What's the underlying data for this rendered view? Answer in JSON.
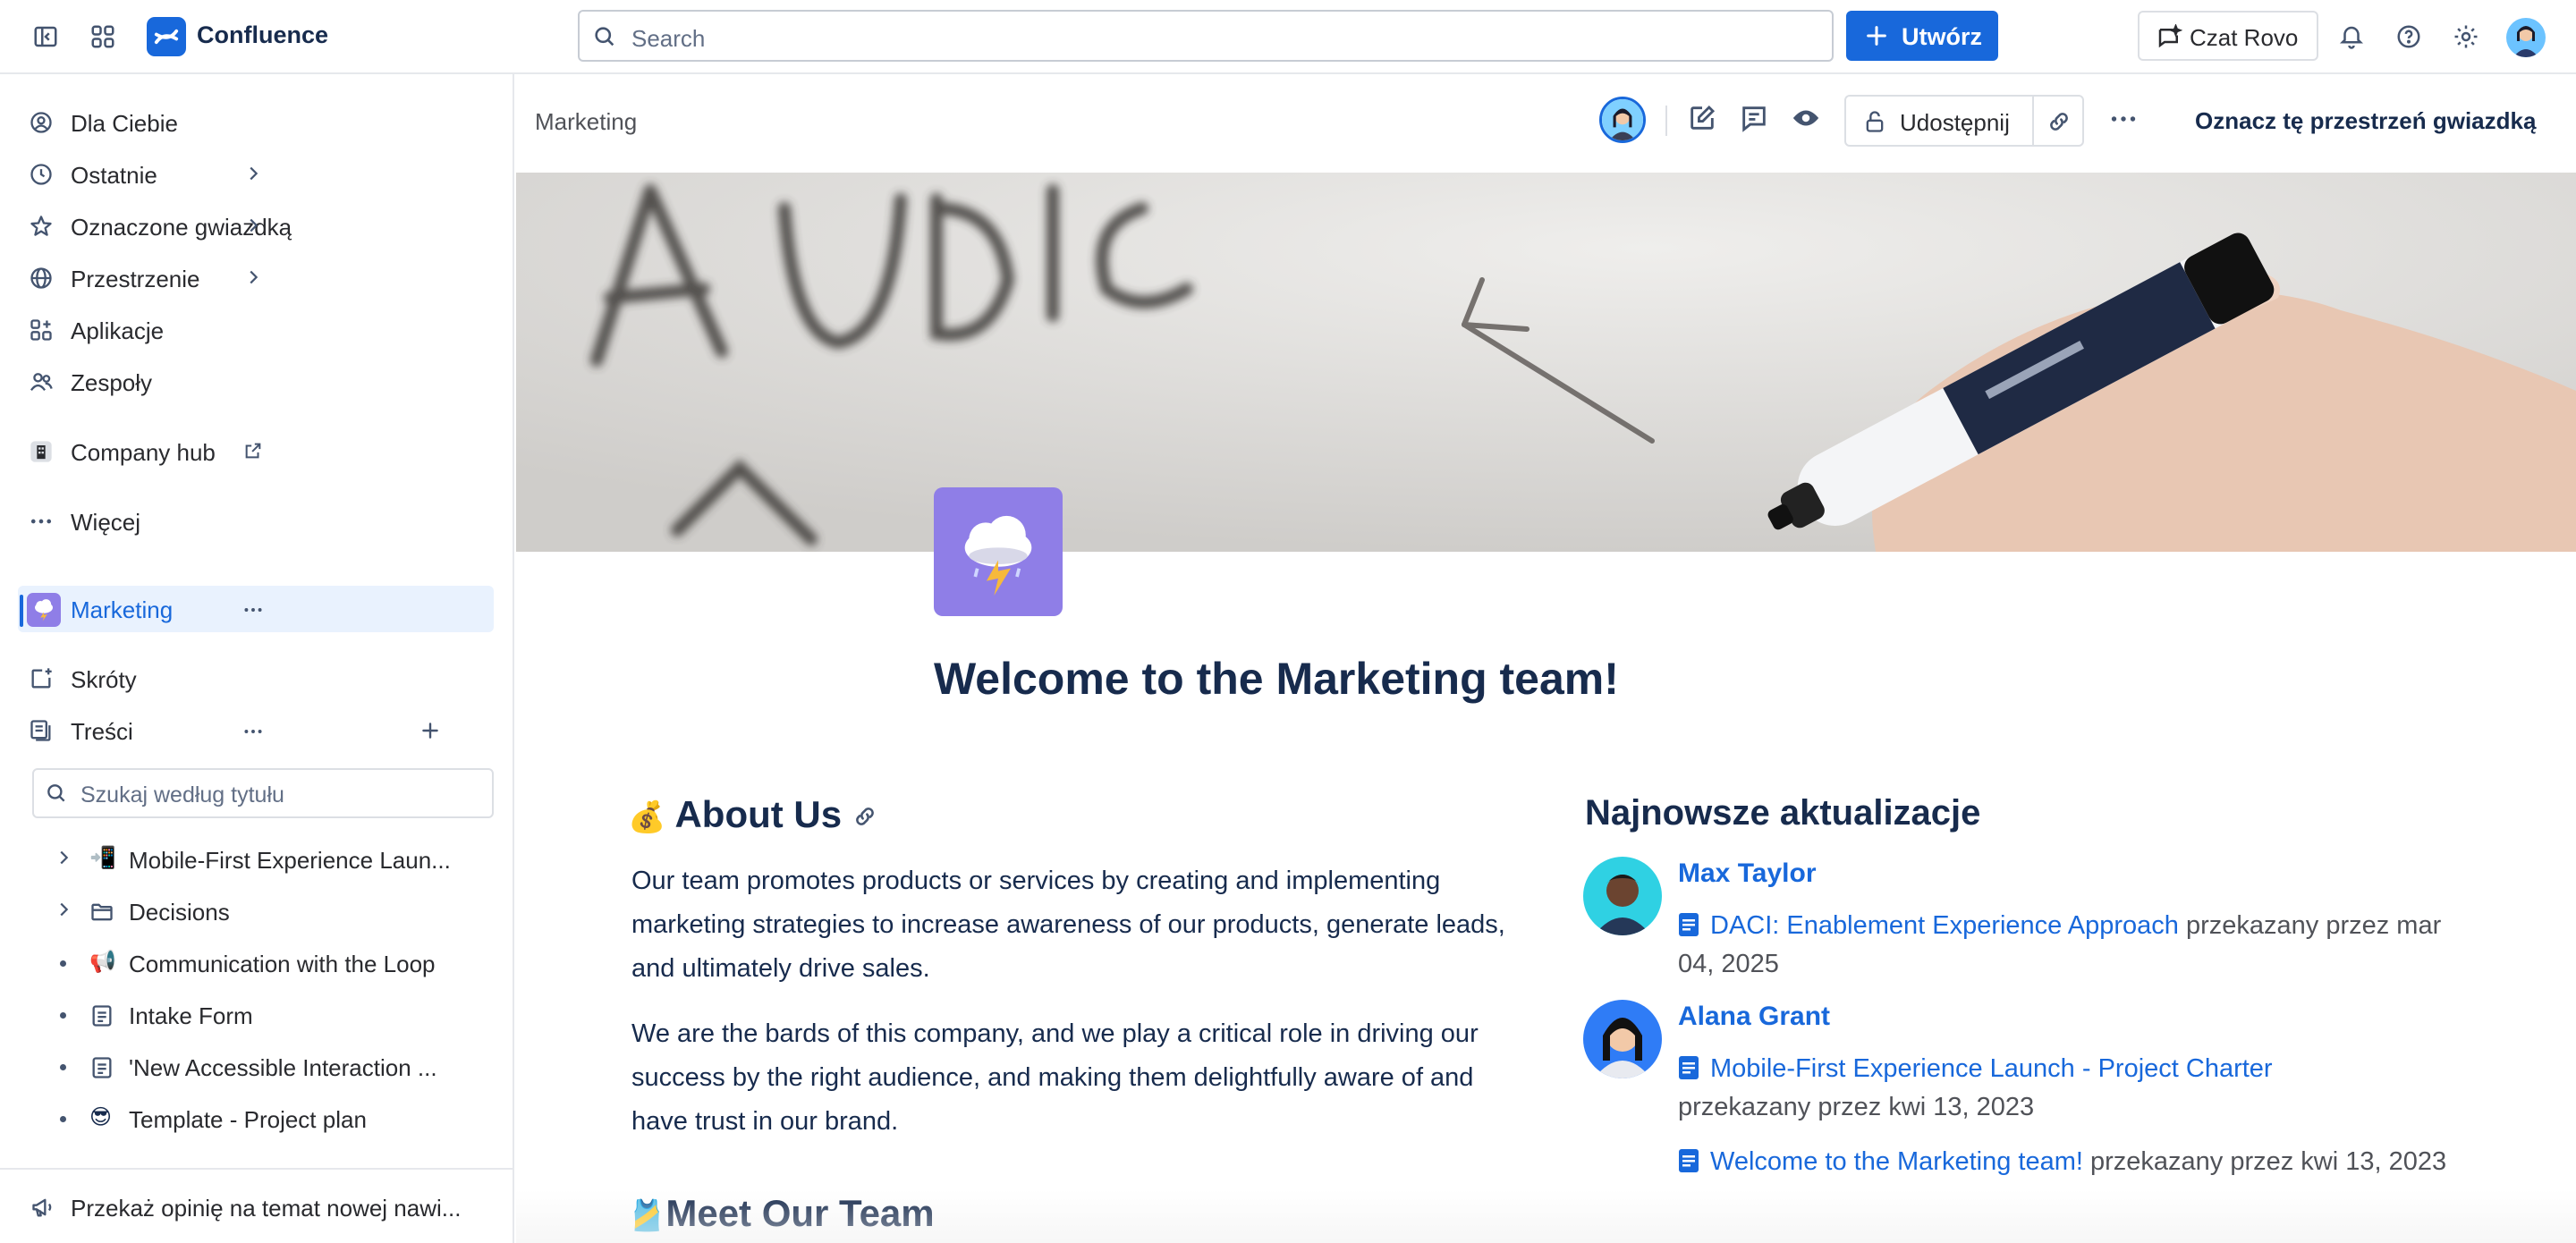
{
  "topbar": {
    "app_name": "Confluence",
    "search_placeholder": "Search",
    "create_label": "Utwórz",
    "rovo_label": "Czat Rovo"
  },
  "sidebar": {
    "items": [
      {
        "label": "Dla Ciebie",
        "icon": "user-circle-icon"
      },
      {
        "label": "Ostatnie",
        "icon": "clock-icon"
      },
      {
        "label": "Oznaczone gwiazdką",
        "icon": "star-icon"
      },
      {
        "label": "Przestrzenie",
        "icon": "globe-icon"
      },
      {
        "label": "Aplikacje",
        "icon": "apps-icon"
      },
      {
        "label": "Zespoły",
        "icon": "people-icon"
      }
    ],
    "company_hub": "Company hub",
    "more": "Więcej",
    "space": "Marketing",
    "shortcuts": "Skróty",
    "content": "Treści",
    "search_placeholder": "Szukaj według tytułu",
    "tree": [
      {
        "label": "Mobile-First Experience Laun...",
        "emoji": "📲",
        "kind": "expand"
      },
      {
        "label": "Decisions",
        "emoji": "",
        "kind": "expand-folder"
      },
      {
        "label": "Communication with the Loop",
        "emoji": "📢",
        "kind": "bullet"
      },
      {
        "label": "Intake Form",
        "emoji": "",
        "kind": "bullet-page"
      },
      {
        "label": "'New Accessible Interaction ...",
        "emoji": "",
        "kind": "bullet-page"
      },
      {
        "label": "Template - Project plan",
        "emoji": "😎",
        "kind": "bullet"
      }
    ],
    "feedback": "Przekaż opinię na temat nowej nawi..."
  },
  "page_header": {
    "breadcrumb": "Marketing",
    "share_label": "Udostępnij",
    "star_space_label": "Oznacz tę przestrzeń gwiazdką"
  },
  "page": {
    "title": "Welcome to the Marketing team!",
    "about_emoji": "💰",
    "about_title": "About Us",
    "paragraph1": "Our team promotes products or services by creating and implementing marketing strategies to increase awareness of our products, generate leads, and ultimately drive sales.",
    "paragraph2": "We are the bards of this company, and we play a critical role in driving our success by the right audience, and making them delightfully aware of and have trust in our brand.",
    "team_emoji": "🎽",
    "team_title": "Meet Our Team"
  },
  "updates": {
    "title": "Najnowsze aktualizacje",
    "entries": [
      {
        "name": "Max Taylor",
        "items": [
          {
            "link": "DACI: Enablement Experience Approach",
            "meta": " przekazany przez mar 04, 2025"
          }
        ]
      },
      {
        "name": "Alana Grant",
        "items": [
          {
            "link": "Mobile-First Experience Launch - Project Charter",
            "meta": "przekazany przez kwi 13, 2023"
          },
          {
            "link": "Welcome to the Marketing team!",
            "meta": " przekazany przez kwi 13, 2023"
          }
        ]
      }
    ]
  },
  "colors": {
    "brand": "#1868db",
    "space_purple": "#8f7ee7",
    "text": "#172b4d",
    "subtle": "#505258"
  }
}
